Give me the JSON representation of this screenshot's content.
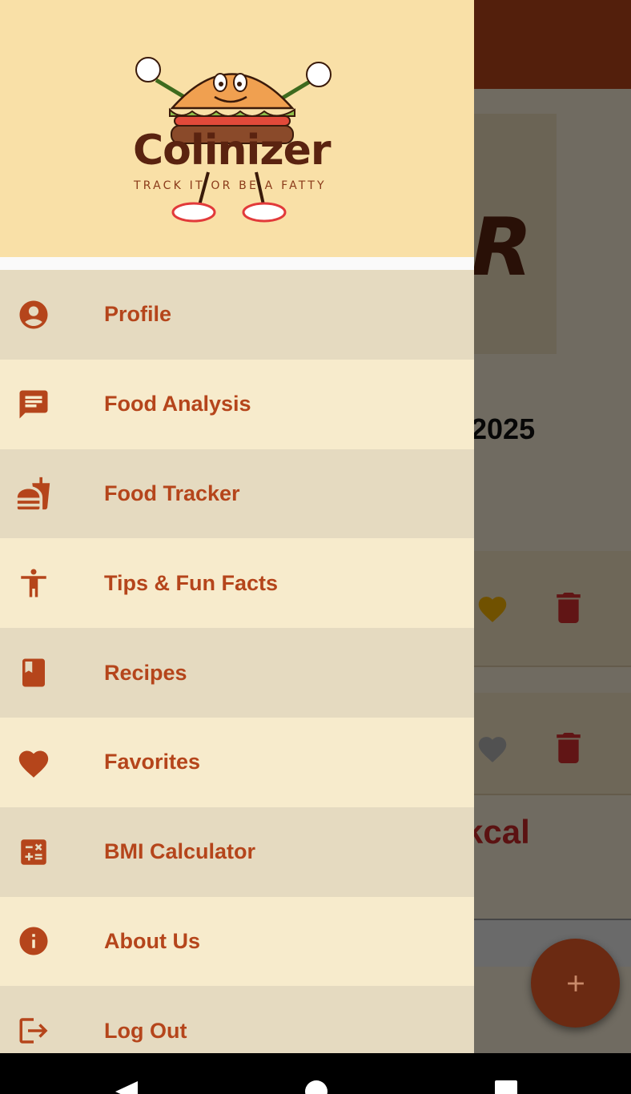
{
  "app": {
    "date_fragment": "2025",
    "kcal_fragment": "kcal",
    "banner_fragment": "R"
  },
  "drawer": {
    "logo": {
      "title": "Colinizer",
      "tagline": "TRACK IT OR BE A FATTY"
    },
    "menu": [
      {
        "label": "Profile",
        "icon": "account-circle-icon"
      },
      {
        "label": "Food Analysis",
        "icon": "message-icon"
      },
      {
        "label": "Food Tracker",
        "icon": "fastfood-icon"
      },
      {
        "label": "Tips & Fun Facts",
        "icon": "accessibility-icon"
      },
      {
        "label": "Recipes",
        "icon": "book-icon"
      },
      {
        "label": "Favorites",
        "icon": "heart-icon"
      },
      {
        "label": "BMI Calculator",
        "icon": "calculator-icon"
      },
      {
        "label": "About Us",
        "icon": "info-icon"
      },
      {
        "label": "Log Out",
        "icon": "logout-icon"
      }
    ]
  },
  "colors": {
    "accent": "#b5451b",
    "drawer_header": "#f9e0a7",
    "row_dark": "#e5dac0",
    "row_light": "#f7ebcc"
  }
}
